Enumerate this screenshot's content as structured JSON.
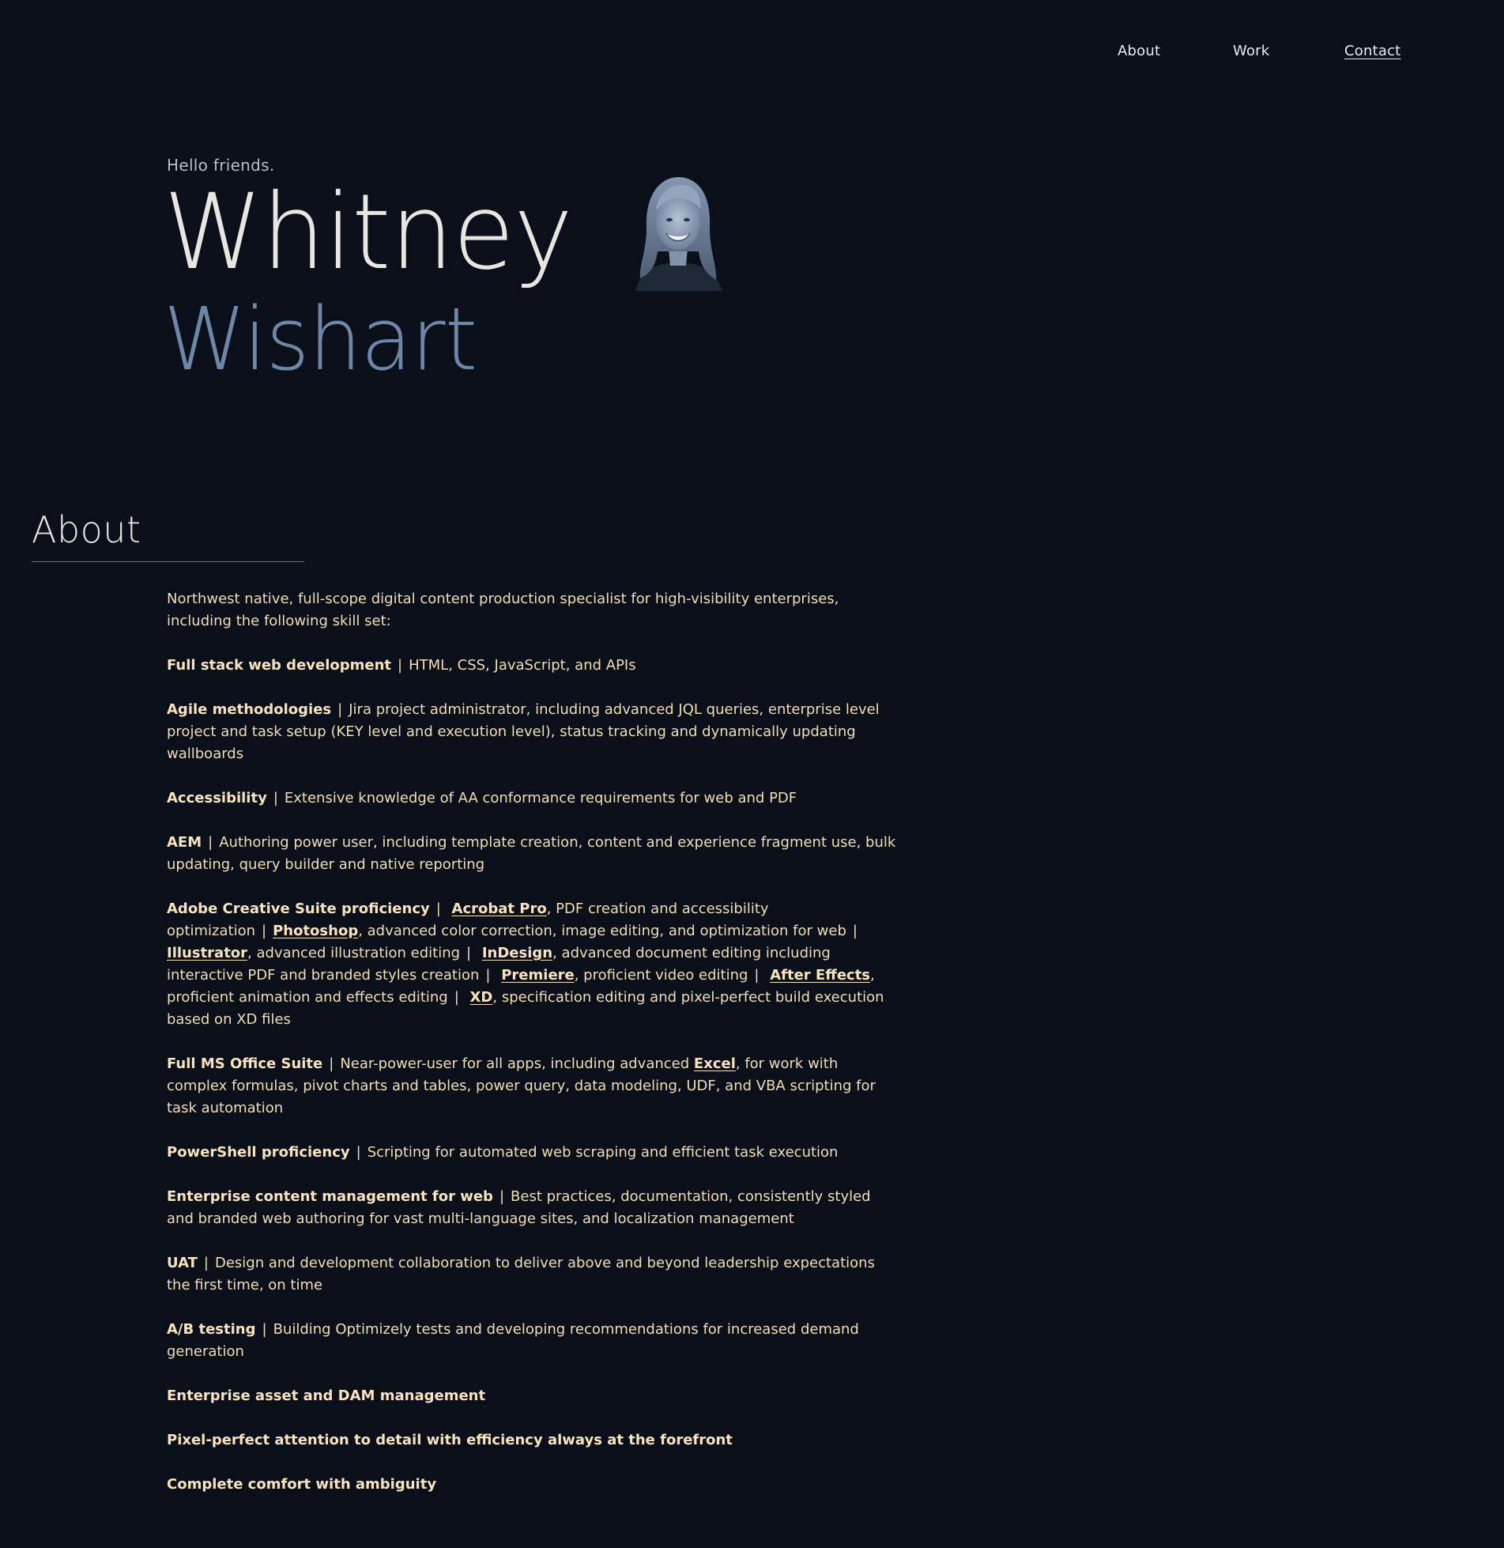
{
  "nav": {
    "about": "About",
    "work": "Work",
    "contact": "Contact"
  },
  "hero": {
    "greeting": "Hello friends.",
    "first_name": "Whitney",
    "last_name": "Wishart"
  },
  "about": {
    "heading": "About",
    "intro": "Northwest native, full-scope digital content production specialist for high-visibility enterprises, including the following skill set:",
    "separator": "|",
    "skills": {
      "fullstack": {
        "title": "Full stack web development",
        "text": "HTML, CSS, JavaScript, and APIs"
      },
      "agile": {
        "title": "Agile methodologies",
        "text": "Jira project administrator, including advanced JQL queries, enterprise level project and task setup (KEY level and execution level), status tracking and dynamically updating wallboards"
      },
      "accessibility": {
        "title": "Accessibility",
        "text": "Extensive knowledge of AA conformance requirements for web and PDF"
      },
      "aem": {
        "title": "AEM",
        "text": "Authoring power user, including template creation, content and experience fragment use, bulk updating, query builder and native reporting"
      },
      "adobe": {
        "title": "Adobe Creative Suite proficiency",
        "acrobat_link": "Acrobat Pro",
        "acrobat_text": ", PDF creation and accessibility optimization",
        "photoshop_link": "Photoshop",
        "photoshop_text": ", advanced color correction, image editing, and optimization for web",
        "illustrator_link": "Illustrator",
        "illustrator_text": ", advanced illustration editing",
        "indesign_link": "InDesign",
        "indesign_text": ", advanced document editing including interactive PDF and branded styles creation",
        "premiere_link": "Premiere",
        "premiere_text": ", proficient video editing",
        "aftereffects_link": "After Effects",
        "aftereffects_text": ", proficient animation and effects editing",
        "xd_link": "XD",
        "xd_text": ", specification editing and pixel-perfect build execution based on XD files"
      },
      "msoffice": {
        "title": "Full MS Office Suite",
        "text_before": "Near-power-user for all apps, including advanced ",
        "excel_link": "Excel",
        "text_after": ", for work with complex formulas, pivot charts and tables, power query, data modeling, UDF, and VBA scripting for task automation"
      },
      "powershell": {
        "title": "PowerShell proficiency",
        "text": "Scripting for automated web scraping and efficient task execution"
      },
      "ecm": {
        "title": "Enterprise content management for web",
        "text": "Best practices, documentation, consistently styled and branded web authoring for vast multi-language sites, and localization management"
      },
      "uat": {
        "title": "UAT",
        "text": "Design and development collaboration to deliver above and beyond leadership expectations the first time, on time"
      },
      "abtesting": {
        "title": "A/B testing",
        "text": "Building Optimizely tests and developing recommendations for increased demand generation"
      },
      "dam": {
        "title": "Enterprise asset and DAM management"
      },
      "pixel": {
        "title": "Pixel-perfect attention to detail with efficiency always at the forefront"
      },
      "ambiguity": {
        "title": "Complete comfort with ambiguity"
      }
    }
  }
}
